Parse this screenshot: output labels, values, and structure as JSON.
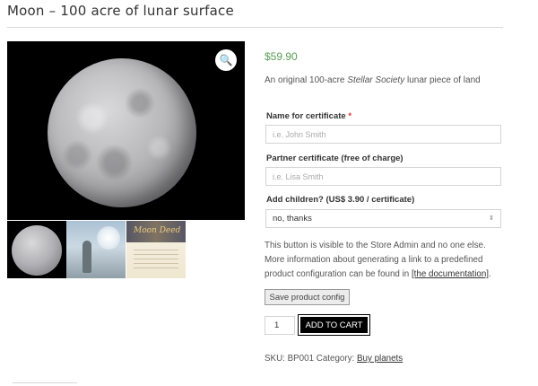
{
  "product": {
    "title": "Moon – 100 acre of lunar surface",
    "price": "$59.90",
    "description_prefix": "An original 100-acre ",
    "description_em": "Stellar Society",
    "description_suffix": " lunar piece of land"
  },
  "gallery": {
    "zoom_icon": "magnifier-icon",
    "thumb_deed_title": "Moon Deed"
  },
  "form": {
    "name_label": "Name for certificate",
    "name_required_mark": "*",
    "name_placeholder": "i.e. John Smith",
    "partner_label": "Partner certificate (free of charge)",
    "partner_placeholder": "i.e. Lisa Smith",
    "children_label": "Add children? (US$ 3.90 / certificate)",
    "children_selected": "no, thanks",
    "children_arrow": "⇕"
  },
  "admin_note": {
    "text": "This button is visible to the Store Admin and no one else. More information about generating a link to a predefined product configuration can be found in ",
    "link": "[the documentation]",
    "suffix": "."
  },
  "actions": {
    "save_config": "Save product config",
    "quantity": "1",
    "add_to_cart": "ADD TO CART"
  },
  "meta": {
    "sku_label": "SKU:",
    "sku": "BP001",
    "category_label": "Category:",
    "category": "Buy planets"
  }
}
